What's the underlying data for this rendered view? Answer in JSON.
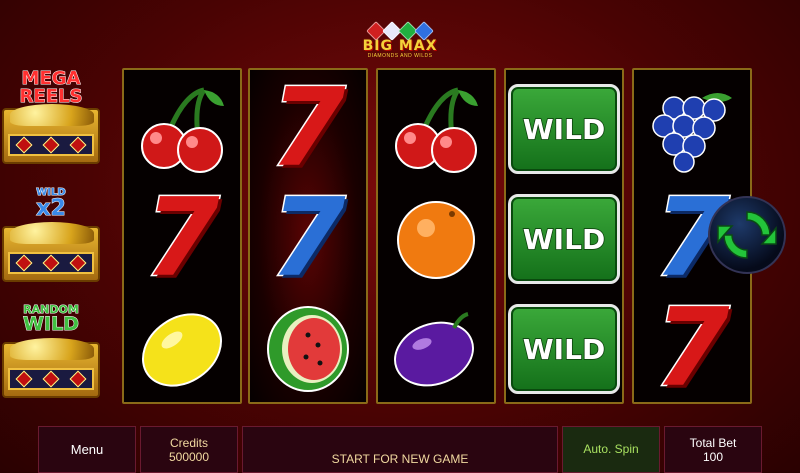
{
  "logo": {
    "title": "BIG MAX",
    "subtitle": "DIAMONDS AND WILDS"
  },
  "features": [
    {
      "label_line1": "MEGA",
      "label_line2": "REELS"
    },
    {
      "label_line1": "WILD",
      "label_line2": "x2"
    },
    {
      "label_line1": "RANDOM",
      "label_line2": "WILD"
    }
  ],
  "reels": [
    [
      "cherry",
      "seven-red",
      "lemon"
    ],
    [
      "seven-red",
      "seven-blue",
      "watermelon"
    ],
    [
      "cherry",
      "orange",
      "plum"
    ],
    [
      "wild",
      "wild",
      "wild"
    ],
    [
      "grapes",
      "seven-blue",
      "seven-red"
    ]
  ],
  "symbols": {
    "seven": "7",
    "wild": "WILD"
  },
  "bottom_bar": {
    "menu": "Menu",
    "credits_label": "Credits",
    "credits_value": "500000",
    "status": "START FOR NEW GAME",
    "auto_spin": "Auto. Spin",
    "total_bet_label": "Total Bet",
    "total_bet_value": "100"
  },
  "colors": {
    "background": "#4a0303",
    "reel_border": "#8a6a18",
    "wild_green": "#2a9a2e",
    "spin_green": "#23c43a"
  }
}
